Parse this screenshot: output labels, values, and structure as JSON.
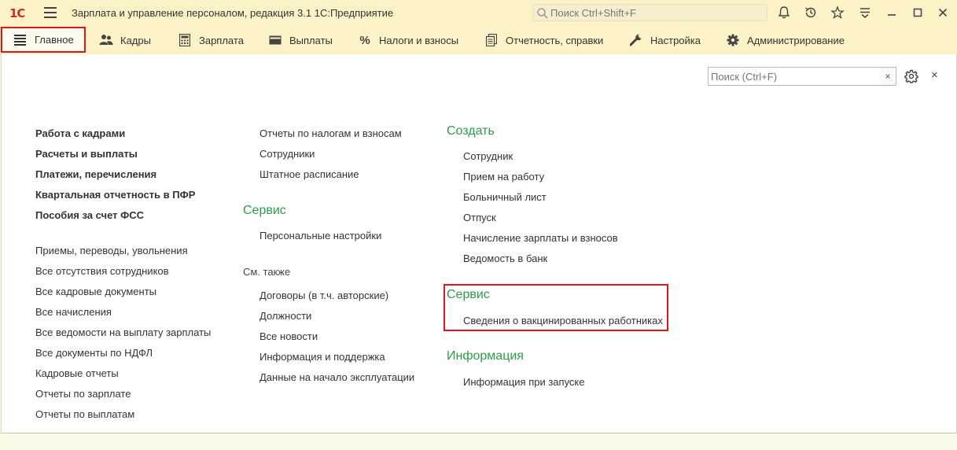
{
  "titlebar": {
    "logo": "1С",
    "title": "Зарплата и управление персоналом, редакция 3.1 1С:Предприятие",
    "search_placeholder": "Поиск Ctrl+Shift+F"
  },
  "sections": [
    {
      "label": "Главное",
      "icon": "menu-icon"
    },
    {
      "label": "Кадры",
      "icon": "people-icon"
    },
    {
      "label": "Зарплата",
      "icon": "calculator-icon"
    },
    {
      "label": "Выплаты",
      "icon": "wallet-icon"
    },
    {
      "label": "Налоги и взносы",
      "icon": "percent-icon"
    },
    {
      "label": "Отчетность, справки",
      "icon": "documents-icon"
    },
    {
      "label": "Настройка",
      "icon": "wrench-icon"
    },
    {
      "label": "Администрирование",
      "icon": "gear-icon"
    }
  ],
  "panel": {
    "search_placeholder": "Поиск (Ctrl+F)",
    "clear": "×",
    "close": "×"
  },
  "col1": {
    "bold_links": [
      "Работа с кадрами",
      "Расчеты и выплаты",
      "Платежи, перечисления",
      "Квартальная отчетность в ПФР",
      "Пособия за счет ФСС"
    ],
    "links": [
      "Приемы, переводы, увольнения",
      "Все отсутствия сотрудников",
      "Все кадровые документы",
      "Все начисления",
      "Все ведомости на выплату зарплаты",
      "Все документы по НДФЛ",
      "Кадровые отчеты",
      "Отчеты по зарплате",
      "Отчеты по выплатам"
    ]
  },
  "col2": {
    "links_top": [
      "Отчеты по налогам и взносам",
      "Сотрудники",
      "Штатное расписание"
    ],
    "service_title": "Сервис",
    "service_links": [
      "Персональные настройки"
    ],
    "see_also_title": "См. также",
    "see_also_links": [
      "Договоры (в т.ч. авторские)",
      "Должности",
      "Все новости",
      "Информация и поддержка",
      "Данные на начало эксплуатации"
    ]
  },
  "col3": {
    "create_title": "Создать",
    "create_links": [
      "Сотрудник",
      "Прием на работу",
      "Больничный лист",
      "Отпуск",
      "Начисление зарплаты и взносов",
      "Ведомость в банк"
    ],
    "service_title": "Сервис",
    "service_links": [
      "Сведения о вакцинированных работниках"
    ],
    "info_title": "Информация",
    "info_links": [
      "Информация при запуске"
    ]
  }
}
